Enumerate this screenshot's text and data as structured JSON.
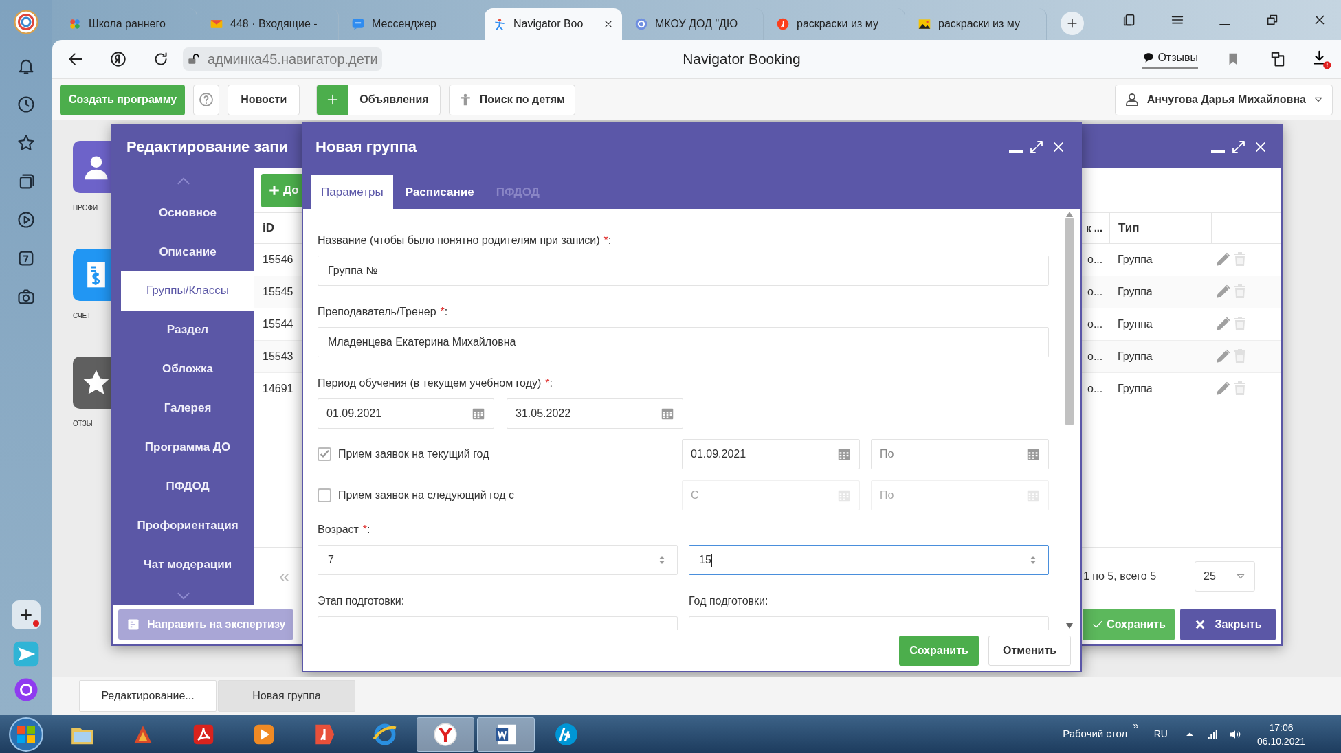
{
  "browser": {
    "tabs": [
      {
        "kind": "puzzle",
        "label": "Школа раннего",
        "selected": false
      },
      {
        "kind": "mail",
        "label": "448 · Входящие -",
        "selected": false
      },
      {
        "kind": "chat",
        "label": "Мессенджер",
        "selected": false
      },
      {
        "kind": "navigator",
        "label": "Navigator Boo",
        "selected": true
      },
      {
        "kind": "shield",
        "label": "МКОУ ДОД \"ДЮ",
        "selected": false
      },
      {
        "kind": "yandex",
        "label": "раскраски из му",
        "selected": false
      },
      {
        "kind": "image",
        "label": "раскраски из му",
        "selected": false
      }
    ],
    "address": "админка45.навигатор.дети",
    "page_title": "Navigator Booking",
    "reviews": "Отзывы"
  },
  "site_toolbar": {
    "create": "Создать программу",
    "news": "Новости",
    "ads": "Объявления",
    "child_search": "Поиск по детям",
    "user": "Анчугова Дарья Михайловна"
  },
  "desktop_icons": [
    {
      "kind": "profile",
      "label": "ПРОФИ"
    },
    {
      "kind": "invoice",
      "label": "СЧЕТ"
    },
    {
      "kind": "review",
      "label": "ОТЗЫ"
    }
  ],
  "record_window": {
    "title": "Редактирование запи",
    "nav": [
      {
        "label": "Основное",
        "selected": false
      },
      {
        "label": "Описание",
        "selected": false
      },
      {
        "label": "Группы/Классы",
        "selected": true
      },
      {
        "label": "Раздел",
        "selected": false
      },
      {
        "label": "Обложка",
        "selected": false
      },
      {
        "label": "Галерея",
        "selected": false
      },
      {
        "label": "Программа ДО",
        "selected": false
      },
      {
        "label": "ПФДОД",
        "selected": false
      },
      {
        "label": "Профориентация",
        "selected": false
      },
      {
        "label": "Чат модерации",
        "selected": false
      }
    ],
    "add_button": "До",
    "table": {
      "columns": [
        "iD",
        "к ...",
        "Тип"
      ],
      "rows": [
        {
          "id": "15546",
          "column_2": "о...",
          "type": "Группа"
        },
        {
          "id": "15545",
          "column_2": "о...",
          "type": "Группа"
        },
        {
          "id": "15544",
          "column_2": "о...",
          "type": "Группа"
        },
        {
          "id": "15543",
          "column_2": "о...",
          "type": "Группа"
        },
        {
          "id": "14691",
          "column_2": "о...",
          "type": "Группа"
        }
      ]
    },
    "pager": {
      "first": "«",
      "summary": "1 по 5, всего 5",
      "page_size": "25"
    },
    "expertise_button": "Направить на экспертизу",
    "save": "Сохранить",
    "close": "Закрыть"
  },
  "dialog": {
    "title": "Новая группа",
    "tabs": [
      {
        "label": "Параметры",
        "selected": true,
        "disabled": false
      },
      {
        "label": "Расписание",
        "selected": false,
        "disabled": false
      },
      {
        "label": "ПФДОД",
        "selected": false,
        "disabled": true
      }
    ],
    "fields": [
      {
        "kind": "text",
        "label": "Название (чтобы было понятно родителям при записи)",
        "mark": "*",
        "punct": ":",
        "value": "Группа №"
      },
      {
        "kind": "text",
        "label": "Преподаватель/Тренер",
        "mark": "*",
        "punct": ":",
        "value": "Младенцева Екатерина Михайловна"
      },
      {
        "kind": "date_range",
        "label": "Период обучения (в текущем учебном году)",
        "mark": "*",
        "punct": ":",
        "from": {
          "value": "01.09.2021"
        },
        "to": {
          "value": "31.05.2022"
        }
      },
      {
        "kind": "checkbox_range",
        "label": "Прием заявок на текущий год",
        "checked": true,
        "from": {
          "value": "01.09.2021"
        },
        "to": {
          "placeholder": "По"
        }
      },
      {
        "kind": "checkbox_range",
        "label": "Прием заявок на следующий год с",
        "checked": false,
        "from": {
          "placeholder": "С"
        },
        "to": {
          "placeholder": "По"
        }
      },
      {
        "kind": "number_range",
        "label": "Возраст",
        "mark": "*",
        "punct": ":",
        "from": {
          "value": "7",
          "focused": false
        },
        "to": {
          "value": "15",
          "focused": true
        }
      },
      {
        "kind": "select_pair",
        "items": [
          {
            "label": "Этап подготовки:"
          },
          {
            "label": "Год подготовки:"
          }
        ]
      }
    ],
    "save": "Сохранить",
    "cancel": "Отменить"
  },
  "page_tabs": [
    {
      "label": "Редактирование...",
      "selected": false
    },
    {
      "label": "Новая группа",
      "selected": true
    }
  ],
  "taskbar": {
    "apps": [
      {
        "kind": "folder",
        "open": false
      },
      {
        "kind": "game",
        "open": false
      },
      {
        "kind": "acrobat",
        "open": false
      },
      {
        "kind": "media",
        "open": false
      },
      {
        "kind": "yabrowser",
        "open": false
      },
      {
        "kind": "ie",
        "open": false
      },
      {
        "kind": "yandex",
        "open": true
      },
      {
        "kind": "word",
        "open": true
      },
      {
        "kind": "hp",
        "open": false
      }
    ],
    "desktop": "Рабочий стол",
    "chevron": "»",
    "lang": "RU",
    "time": "17:06",
    "date": "06.10.2021"
  }
}
